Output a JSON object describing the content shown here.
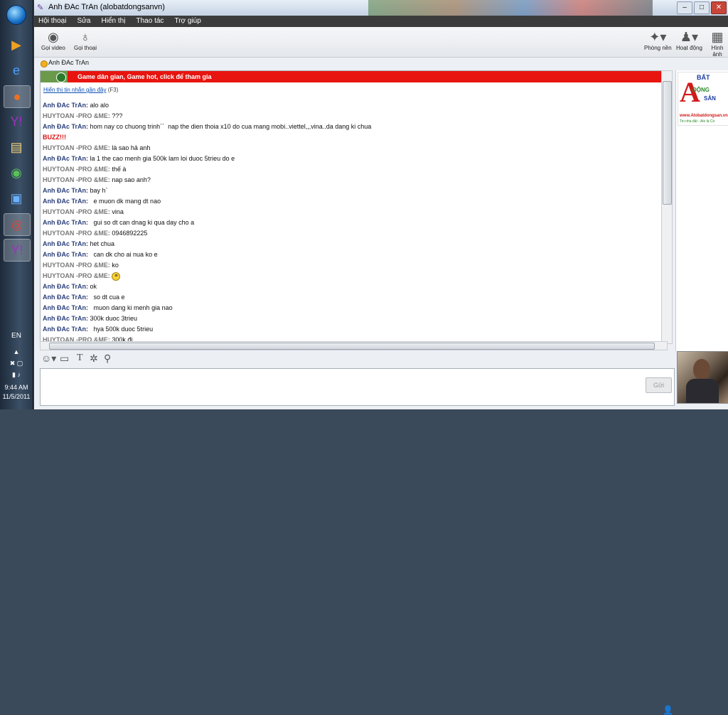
{
  "taskbar": {
    "language": "EN",
    "time": "9:44 AM",
    "date": "11/5/2011"
  },
  "window": {
    "title": "Anh ĐAc TrAn (alobatdongsanvn)"
  },
  "menu": {
    "items": [
      "Hội thoại",
      "Sửa",
      "Hiển thị",
      "Thao tác",
      "Trợ giúp"
    ]
  },
  "toolbar": {
    "video_call": "Gọi video",
    "voice_call": "Gọi thoại",
    "rooms": "Phòng nền",
    "activity": "Hoạt động",
    "image": "Hình ảnh"
  },
  "contact": {
    "name": "Anh ĐAc TrAn"
  },
  "chat": {
    "banner": "Game dân gian, Game hot, click để tham gia",
    "history_link": "Hiển thị tin nhắn gần đây",
    "history_key": "(F3)",
    "messages": [
      {
        "sender": "Anh ĐAc TrAn:",
        "text": "alo alo",
        "who": "a"
      },
      {
        "sender": "HUYTOAN -PRO &ME:",
        "text": "???",
        "who": "b"
      },
      {
        "sender": "Anh ĐAc TrAn:",
        "text": "hom nay co chuong trinh``  nap the dien thoia x10 do cua mang mobi..viettel,,,vina..da dang ki chua",
        "who": "a"
      },
      {
        "sender": "",
        "text": "BUZZ!!!",
        "who": "buzz"
      },
      {
        "sender": "HUYTOAN -PRO &ME:",
        "text": "là sao hả anh",
        "who": "b"
      },
      {
        "sender": "Anh ĐAc TrAn:",
        "text": "la 1 the cao menh gia 500k lam loi duoc 5trieu do e",
        "who": "a"
      },
      {
        "sender": "HUYTOAN -PRO &ME:",
        "text": "thế à",
        "who": "b"
      },
      {
        "sender": "HUYTOAN -PRO &ME:",
        "text": "nap sao anh?",
        "who": "b"
      },
      {
        "sender": "Anh ĐAc TrAn:",
        "text": "bay h`",
        "who": "a"
      },
      {
        "sender": "Anh ĐAc TrAn:",
        "text": "  e muon dk mang dt nao",
        "who": "a"
      },
      {
        "sender": "HUYTOAN -PRO &ME:",
        "text": "vina",
        "who": "b"
      },
      {
        "sender": "Anh ĐAc TrAn:",
        "text": "  gui so dt can dnag ki qua day cho a",
        "who": "a"
      },
      {
        "sender": "HUYTOAN -PRO &ME:",
        "text": "0946892225",
        "who": "b"
      },
      {
        "sender": "Anh ĐAc TrAn:",
        "text": "het chua",
        "who": "a"
      },
      {
        "sender": "Anh ĐAc TrAn:",
        "text": "  can dk cho ai nua ko e",
        "who": "a"
      },
      {
        "sender": "HUYTOAN -PRO &ME:",
        "text": "ko",
        "who": "b"
      },
      {
        "sender": "HUYTOAN -PRO &ME:",
        "text": "",
        "who": "b",
        "emoticon": true
      },
      {
        "sender": "Anh ĐAc TrAn:",
        "text": "ok",
        "who": "a"
      },
      {
        "sender": "Anh ĐAc TrAn:",
        "text": "  so dt cua e",
        "who": "a"
      },
      {
        "sender": "Anh ĐAc TrAn:",
        "text": "  muon dang ki menh gia nao",
        "who": "a"
      },
      {
        "sender": "Anh ĐAc TrAn:",
        "text": "300k duoc 3trieu",
        "who": "a"
      },
      {
        "sender": "Anh ĐAc TrAn:",
        "text": "  hya 500k duoc 5trieu",
        "who": "a"
      },
      {
        "sender": "HUYTOAN -PRO &ME:",
        "text": "300k đi",
        "who": "b"
      }
    ]
  },
  "input": {
    "send_label": "Gửi"
  },
  "ad": {
    "letter": "A",
    "word_bat": "BẤT",
    "word_dong": "ĐỘNG",
    "word_san": "SẢN",
    "site": "www.Alobatdongsan.vn",
    "slogan": "Tin nhà đất - Alo là Có"
  }
}
